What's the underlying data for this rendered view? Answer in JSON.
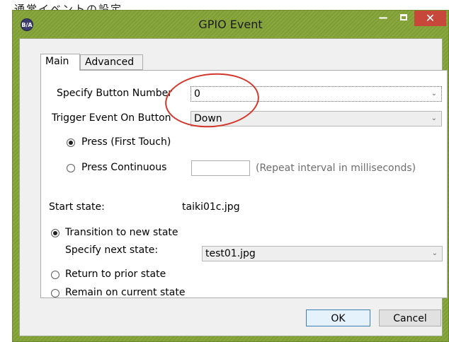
{
  "caption": "通常イベントの設定",
  "window": {
    "title": "GPIO Event",
    "icon_text": "B/A",
    "icon": "app-icon",
    "controls": {
      "minimize": "minimize-icon",
      "maximize": "maximize-icon",
      "close": "close-icon"
    }
  },
  "tabs": [
    {
      "label": "Main",
      "selected": true
    },
    {
      "label": "Advanced",
      "selected": false
    }
  ],
  "main": {
    "button_number_label": "Specify Button Number",
    "button_number_value": "0",
    "trigger_label": "Trigger Event On Button",
    "trigger_value": "Down",
    "press_first_label": "Press (First Touch)",
    "press_continuous_label": "Press Continuous",
    "repeat_interval_value": "",
    "repeat_hint": "(Repeat interval in milliseconds)",
    "start_state_label": "Start state:",
    "start_state_value": "taiki01c.jpg",
    "transition_label": "Transition to new state",
    "next_state_label": "Specify next state:",
    "next_state_value": "test01.jpg",
    "return_label": "Return to prior state",
    "remain_label": "Remain on current state"
  },
  "buttons": {
    "ok": "OK",
    "cancel": "Cancel"
  },
  "colors": {
    "titlebar": "#8aa83f",
    "close": "#c7483b",
    "annotation": "#d4362b",
    "dialog_bg": "#f0f0f0"
  }
}
